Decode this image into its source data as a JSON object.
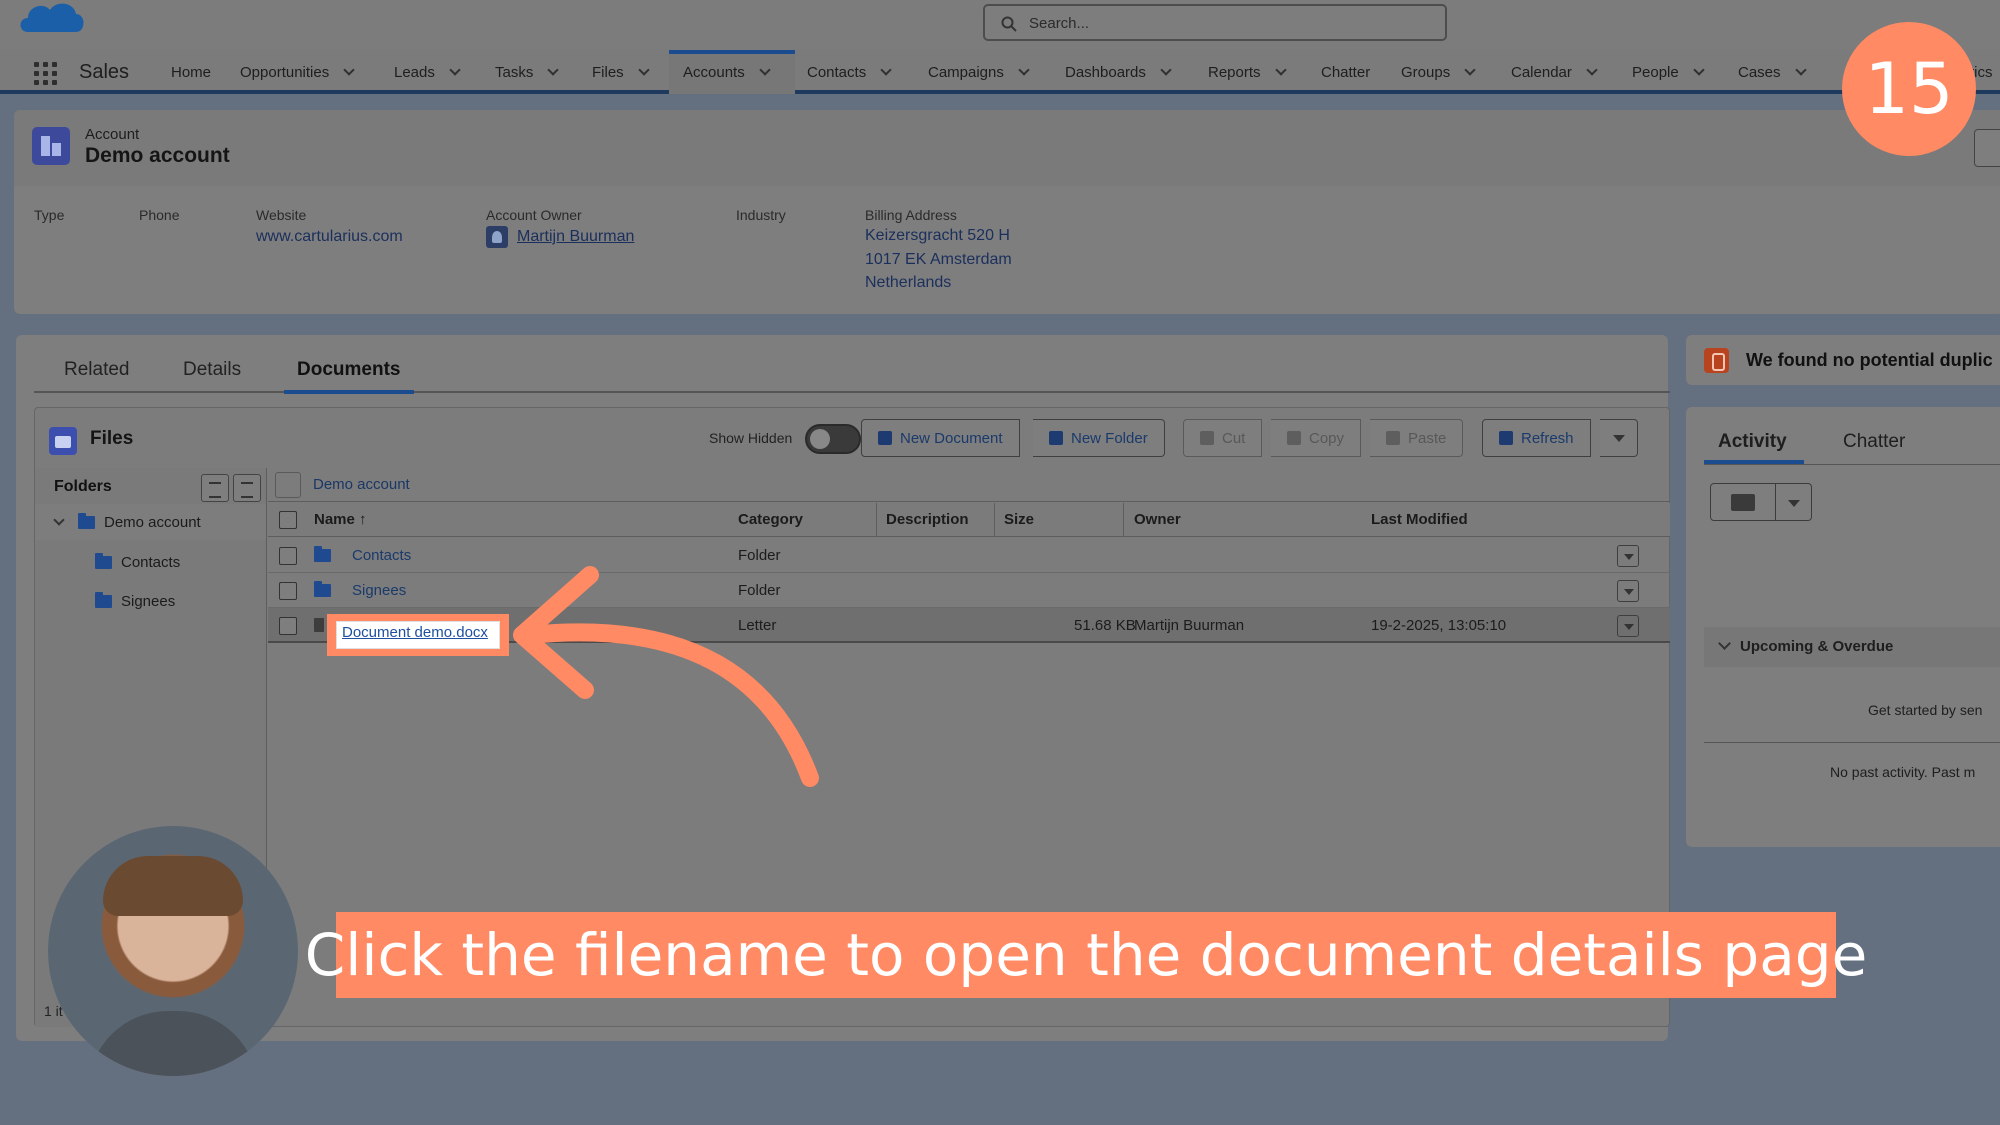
{
  "header": {
    "search_placeholder": "Search...",
    "app_name": "Sales"
  },
  "nav": {
    "items": [
      {
        "label": "Home"
      },
      {
        "label": "Opportunities"
      },
      {
        "label": "Leads"
      },
      {
        "label": "Tasks"
      },
      {
        "label": "Files"
      },
      {
        "label": "Accounts"
      },
      {
        "label": "Contacts"
      },
      {
        "label": "Campaigns"
      },
      {
        "label": "Dashboards"
      },
      {
        "label": "Reports"
      },
      {
        "label": "Chatter"
      },
      {
        "label": "Groups"
      },
      {
        "label": "Calendar"
      },
      {
        "label": "People"
      },
      {
        "label": "Cases"
      },
      {
        "label": "tics"
      }
    ],
    "active": "Accounts"
  },
  "account": {
    "object_label": "Account",
    "name": "Demo account",
    "fields": {
      "type_label": "Type",
      "phone_label": "Phone",
      "website_label": "Website",
      "website_value": "www.cartularius.com",
      "owner_label": "Account Owner",
      "owner_value": "Martijn Buurman",
      "industry_label": "Industry",
      "billing_label": "Billing Address",
      "billing_line1": "Keizersgracht 520 H",
      "billing_line2": "1017 EK Amsterdam",
      "billing_line3": "Netherlands"
    }
  },
  "tabs": {
    "related": "Related",
    "details": "Details",
    "documents": "Documents",
    "active": "Documents"
  },
  "files": {
    "title": "Files",
    "show_hidden_label": "Show Hidden",
    "show_hidden_on": false,
    "toolbar": {
      "new_document": "New Document",
      "new_folder": "New Folder",
      "cut": "Cut",
      "copy": "Copy",
      "paste": "Paste",
      "refresh": "Refresh"
    },
    "folders_header": "Folders",
    "tree": {
      "root": "Demo account",
      "children": [
        "Contacts",
        "Signees"
      ]
    },
    "breadcrumb": "Demo account",
    "columns": {
      "name": "Name ↑",
      "category": "Category",
      "description": "Description",
      "size": "Size",
      "owner": "Owner",
      "last_modified": "Last Modified"
    },
    "rows": [
      {
        "name": "Contacts",
        "category": "Folder",
        "size": "",
        "owner": "",
        "modified": ""
      },
      {
        "name": "Signees",
        "category": "Folder",
        "size": "",
        "owner": "",
        "modified": ""
      },
      {
        "name": "Document demo.docx",
        "category": "Letter",
        "size": "51.68 KB",
        "owner": "Martijn Buurman",
        "modified": "19-2-2025, 13:05:10"
      }
    ],
    "footer": "1 it"
  },
  "sidebar": {
    "duplicates": "We found no potential duplic",
    "activity_tab": "Activity",
    "chatter_tab": "Chatter",
    "upcoming": "Upcoming & Overdue",
    "get_started": "Get started by sen",
    "no_past": "No past activity. Past m"
  },
  "overlay": {
    "step_number": "15",
    "caption": "Click the filename to open the document details page",
    "accent_color": "#ff8a63"
  }
}
